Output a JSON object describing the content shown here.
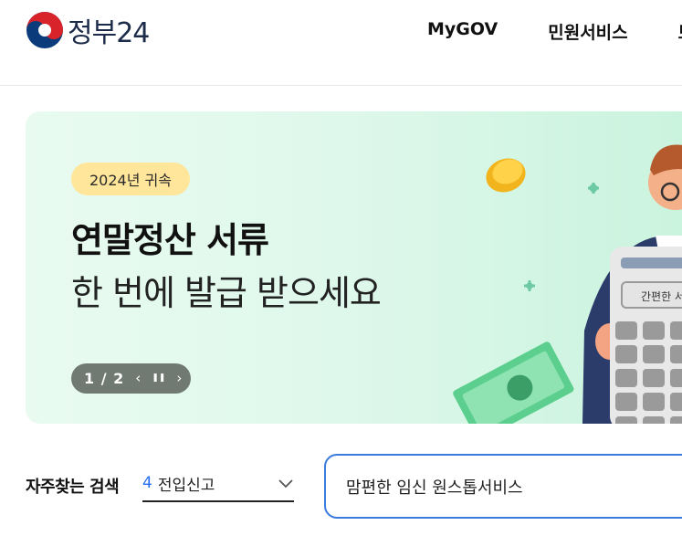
{
  "header": {
    "logo_text": "정부24",
    "nav": [
      "MyGOV",
      "민원서비스",
      "보"
    ]
  },
  "banner": {
    "badge": "2024년 귀속",
    "headline_1": "연말정산 서류",
    "headline_2": "한 번에 발급 받으세요",
    "counter": "1 / 2",
    "prev_icon": "‹",
    "pause_icon": "❚❚",
    "next_icon": "›",
    "calc_label": "간편한 서"
  },
  "search": {
    "frequent_label": "자주찾는 검색",
    "frequent_rank": "4",
    "frequent_term": "전입신고",
    "input_value": "맘편한 임신 원스톱서비스"
  },
  "colors": {
    "accent_blue": "#256ef4",
    "badge_yellow": "#ffe69a",
    "banner_green": "#dff8ec",
    "search_border": "#3b7bdc"
  }
}
